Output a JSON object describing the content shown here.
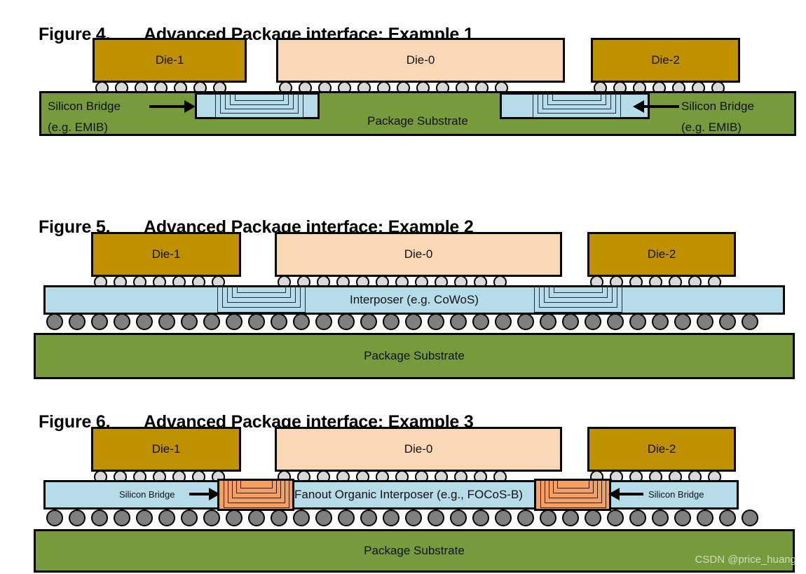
{
  "figures": [
    {
      "number": "Figure 4.",
      "title": "Advanced Package interface: Example 1",
      "dies": [
        {
          "label": "Die-1",
          "color": "#BF9000"
        },
        {
          "label": "Die-0",
          "color": "#FAD7B5"
        },
        {
          "label": "Die-2",
          "color": "#BF9000"
        }
      ],
      "substrate_label": "Package Substrate",
      "bridge_left_label_line1": "Silicon Bridge",
      "bridge_left_label_line2": "(e.g. EMIB)",
      "bridge_right_label_line1": "Silicon Bridge",
      "bridge_right_label_line2": "(e.g. EMIB)",
      "bump_counts": [
        7,
        12,
        7
      ],
      "colors": {
        "substrate": "#769A3C",
        "bridge": "#B5DCE8",
        "bump": "#D9D9D9"
      }
    },
    {
      "number": "Figure 5.",
      "title": "Advanced Package interface: Example 2",
      "dies": [
        {
          "label": "Die-1",
          "color": "#BF9000"
        },
        {
          "label": "Die-0",
          "color": "#FAD7B5"
        },
        {
          "label": "Die-2",
          "color": "#BF9000"
        }
      ],
      "interposer_label": "Interposer (e.g. CoWoS)",
      "substrate_label": "Package Substrate",
      "bump_counts": [
        7,
        12,
        7
      ],
      "ball_count": 32,
      "colors": {
        "substrate": "#769A3C",
        "interposer": "#B5DCE8",
        "bump": "#D9D9D9",
        "ball": "#7F7F7F"
      }
    },
    {
      "number": "Figure 6.",
      "title": "Advanced Package interface: Example 3",
      "dies": [
        {
          "label": "Die-1",
          "color": "#BF9000"
        },
        {
          "label": "Die-0",
          "color": "#FAD7B5"
        },
        {
          "label": "Die-2",
          "color": "#BF9000"
        }
      ],
      "interposer_label": "Fanout Organic Interposer (e.g., FOCoS-B)",
      "bridge_left_label": "Silicon Bridge",
      "bridge_right_label": "Silicon Bridge",
      "substrate_label": "Package Substrate",
      "bump_counts": [
        7,
        12,
        7
      ],
      "ball_count": 32,
      "colors": {
        "substrate": "#769A3C",
        "interposer": "#B5DCE8",
        "bridge": "#F4A060",
        "bump": "#D9D9D9",
        "ball": "#7F7F7F"
      }
    }
  ],
  "watermark": "CSDN @price_huang"
}
